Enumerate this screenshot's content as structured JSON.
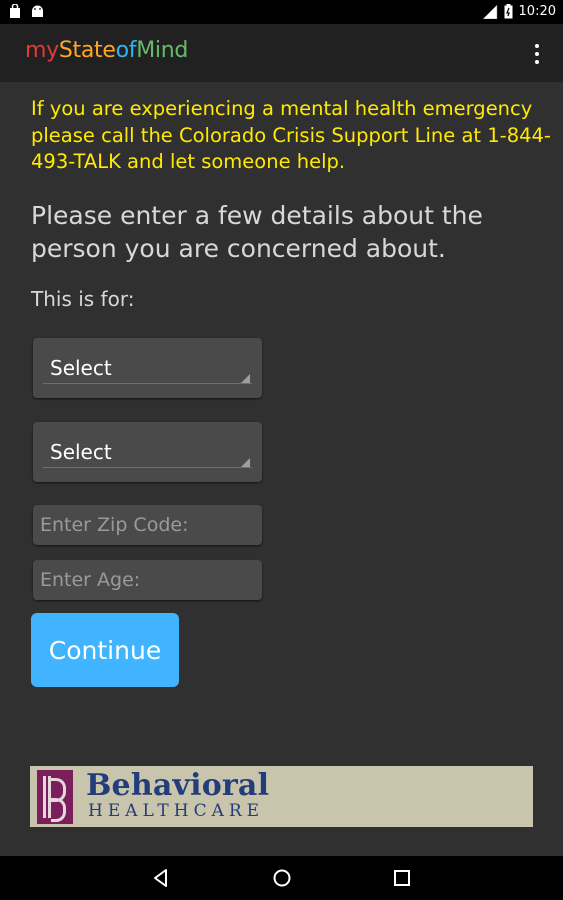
{
  "status_bar": {
    "time": "10:20",
    "left_icons": [
      "shopping-bag-icon",
      "android-icon"
    ],
    "right_icons": [
      "signal-icon",
      "battery-icon"
    ]
  },
  "app_bar": {
    "title_parts": [
      "my",
      "State",
      "of",
      "Mind"
    ],
    "title_colors": [
      "#e53935",
      "#ffa726",
      "#29b6f6",
      "#66bb6a"
    ],
    "menu_icon": "overflow-menu-icon"
  },
  "emergency_message": "If you are experiencing a mental health emergency please call the Colorado Crisis Support Line at 1-844-493-TALK and let someone help.",
  "form": {
    "heading": "Please enter a few details about the person you are concerned about.",
    "for_label": "This is for:",
    "select_1": "Select",
    "select_2": "Select",
    "zip_placeholder": "Enter Zip Code:",
    "age_placeholder": "Enter Age:",
    "continue_label": "Continue"
  },
  "banner": {
    "line1": "Behavioral",
    "line2": "HEALTHCARE"
  },
  "nav_bar": [
    "back-icon",
    "home-icon",
    "recents-icon"
  ],
  "colors": {
    "background": "#303030",
    "emergency_text": "#ffea00",
    "button": "#40b4ff",
    "brand_purple": "#7b1f5c",
    "brand_blue": "#223d7a"
  }
}
